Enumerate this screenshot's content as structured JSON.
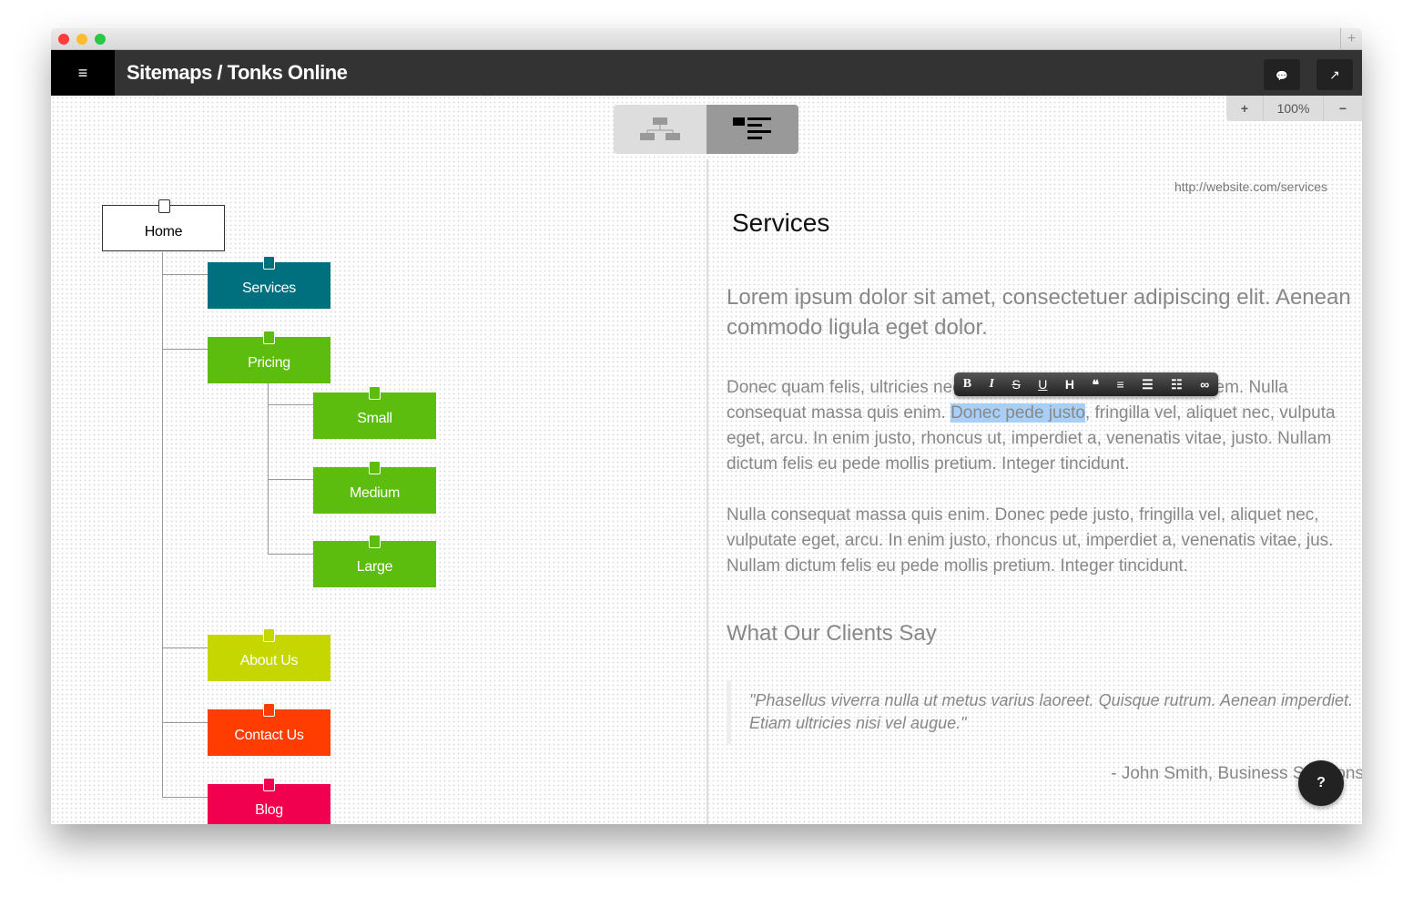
{
  "window": {
    "new_tab": "+"
  },
  "header": {
    "menu_icon": "≡",
    "title": "Sitemaps / Tonks Online",
    "chat_icon": "💬",
    "share_icon": "↗"
  },
  "view_switch": {
    "active": "list"
  },
  "zoom": {
    "plus": "+",
    "level": "100%",
    "minus": "−"
  },
  "tree": [
    {
      "label": "Home",
      "color": "#ffffff"
    },
    {
      "label": "Services",
      "color": "#00707e"
    },
    {
      "label": "Pricing",
      "color": "#5dbd0e"
    },
    {
      "label": "Small",
      "color": "#5dbd0e"
    },
    {
      "label": "Medium",
      "color": "#5dbd0e"
    },
    {
      "label": "Large",
      "color": "#5dbd0e"
    },
    {
      "label": "About Us",
      "color": "#c5d600"
    },
    {
      "label": "Contact Us",
      "color": "#ff3d00"
    },
    {
      "label": "Blog",
      "color": "#f0004e"
    }
  ],
  "page": {
    "url": "http://website.com/services",
    "title": "Services",
    "lead": "Lorem ipsum dolor sit amet, consectetuer adipiscing elit. Aenean commodo ligula eget dolor.",
    "p1_before": "Donec quam felis, ultricies nec, pellentesque eu, pretium quis, sem. Nulla consequat massa quis enim. ",
    "p1_selected": "Donec pede justo",
    "p1_after": ", fringilla vel, aliquet nec, vulputa eget, arcu. In enim justo, rhoncus ut, imperdiet a, venenatis vitae, justo. Nullam dictum felis eu pede mollis pretium. Integer tincidunt.",
    "p2": "Nulla consequat massa quis enim. Donec pede justo, fringilla vel, aliquet nec, vulputate eget, arcu. In enim justo, rhoncus ut, imperdiet a, venenatis vitae, jus. Nullam dictum felis eu pede mollis pretium. Integer tincidunt.",
    "subheading": "What Our Clients Say",
    "quote": "\"Phasellus viverra nulla ut metus varius laoreet. Quisque rutrum. Aenean imperdiet. Etiam ultricies nisi vel augue.\"",
    "author": "- John Smith, Business Solutions"
  },
  "editor_toolbar": [
    "B",
    "I",
    "S",
    "U",
    "H",
    "❝",
    "≡",
    "☰",
    "☷",
    "∞"
  ],
  "help": {
    "icon": "?"
  }
}
